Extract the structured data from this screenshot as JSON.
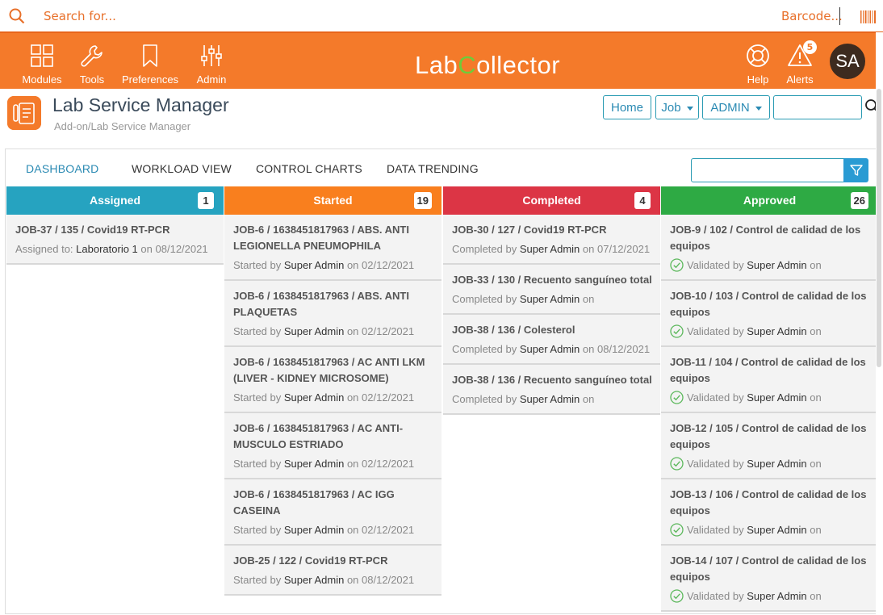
{
  "search": {
    "placeholder": "Search for...",
    "barcode_label": "Barcode..."
  },
  "nav": {
    "left": [
      {
        "label": "Modules",
        "icon": "grid-icon"
      },
      {
        "label": "Tools",
        "icon": "wrench-icon"
      },
      {
        "label": "Preferences",
        "icon": "bookmark-icon"
      },
      {
        "label": "Admin",
        "icon": "sliders-icon"
      }
    ],
    "brand": {
      "part1": "Lab",
      "part2": "C",
      "part3": "ollector"
    },
    "help_label": "Help",
    "alerts_label": "Alerts",
    "alerts_count": "5",
    "avatar_initials": "SA"
  },
  "header": {
    "title": "Lab Service Manager",
    "breadcrumb": "Add-on/Lab Service Manager",
    "home_label": "Home",
    "job_label": "Job",
    "admin_label": "ADMIN"
  },
  "tabs": [
    "DASHBOARD",
    "WORKLOAD VIEW",
    "CONTROL CHARTS",
    "DATA TRENDING"
  ],
  "colors": {
    "brand": "#f47a2a",
    "assigned": "#26a3c0",
    "started": "#f97f1e",
    "completed": "#dc3545",
    "approved": "#2eaa44",
    "accent": "#2a8ab3"
  },
  "columns": [
    {
      "title": "Assigned",
      "count": "1",
      "cards": [
        {
          "title": "JOB-37 / 135 / Covid19 RT-PCR",
          "prefix": "Assigned to:",
          "who": "Laboratorio 1",
          "on": "on",
          "date": "08/12/2021"
        }
      ]
    },
    {
      "title": "Started",
      "count": "19",
      "cards": [
        {
          "title": "JOB-6 / 1638451817963 / ABS. ANTI LEGIONELLA PNEUMOPHILA",
          "prefix": "Started by",
          "who": "Super Admin",
          "on": "on",
          "date": "02/12/2021"
        },
        {
          "title": "JOB-6 / 1638451817963 / ABS. ANTI PLAQUETAS",
          "prefix": "Started by",
          "who": "Super Admin",
          "on": "on",
          "date": "02/12/2021"
        },
        {
          "title": "JOB-6 / 1638451817963 / AC ANTI LKM (LIVER - KIDNEY MICROSOME)",
          "prefix": "Started by",
          "who": "Super Admin",
          "on": "on",
          "date": "02/12/2021"
        },
        {
          "title": "JOB-6 / 1638451817963 / AC ANTI-MUSCULO ESTRIADO",
          "prefix": "Started by",
          "who": "Super Admin",
          "on": "on",
          "date": "02/12/2021"
        },
        {
          "title": "JOB-6 / 1638451817963 / AC IGG CASEINA",
          "prefix": "Started by",
          "who": "Super Admin",
          "on": "on",
          "date": "02/12/2021"
        },
        {
          "title": "JOB-25 / 122 / Covid19 RT-PCR",
          "prefix": "Started by",
          "who": "Super Admin",
          "on": "on",
          "date": "08/12/2021"
        }
      ]
    },
    {
      "title": "Completed",
      "count": "4",
      "cards": [
        {
          "title": "JOB-30 / 127 / Covid19 RT-PCR",
          "prefix": "Completed by",
          "who": "Super Admin",
          "on": "on",
          "date": "07/12/2021"
        },
        {
          "title": "JOB-33 / 130 / Recuento sanguíneo total",
          "prefix": "Completed by",
          "who": "Super Admin",
          "on": "on",
          "date": ""
        },
        {
          "title": "JOB-38 / 136 / Colesterol",
          "prefix": "Completed by",
          "who": "Super Admin",
          "on": "on",
          "date": "08/12/2021"
        },
        {
          "title": "JOB-38 / 136 / Recuento sanguíneo total",
          "prefix": "Completed by",
          "who": "Super Admin",
          "on": "on",
          "date": ""
        }
      ]
    },
    {
      "title": "Approved",
      "count": "26",
      "cards": [
        {
          "title": "JOB-9 / 102 / Control de calidad de los equipos",
          "prefix": "Validated by",
          "who": "Super Admin",
          "on": "on",
          "date": ""
        },
        {
          "title": "JOB-10 / 103 / Control de calidad de los equipos",
          "prefix": "Validated by",
          "who": "Super Admin",
          "on": "on",
          "date": ""
        },
        {
          "title": "JOB-11 / 104 / Control de calidad de los equipos",
          "prefix": "Validated by",
          "who": "Super Admin",
          "on": "on",
          "date": ""
        },
        {
          "title": "JOB-12 / 105 / Control de calidad de los equipos",
          "prefix": "Validated by",
          "who": "Super Admin",
          "on": "on",
          "date": ""
        },
        {
          "title": "JOB-13 / 106 / Control de calidad de los equipos",
          "prefix": "Validated by",
          "who": "Super Admin",
          "on": "on",
          "date": ""
        },
        {
          "title": "JOB-14 / 107 / Control de calidad de los equipos",
          "prefix": "Validated by",
          "who": "Super Admin",
          "on": "on",
          "date": ""
        }
      ]
    }
  ]
}
